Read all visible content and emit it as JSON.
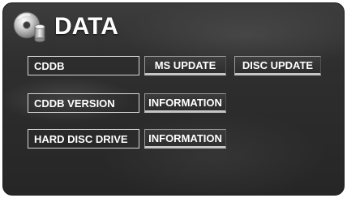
{
  "header": {
    "title": "DATA",
    "icon": "disc-database-icon"
  },
  "rows": [
    {
      "label": "CDDB",
      "buttons": [
        "MS UPDATE",
        "DISC UPDATE"
      ]
    },
    {
      "label": "CDDB VERSION",
      "buttons": [
        "INFORMATION"
      ]
    },
    {
      "label": "HARD DISC DRIVE",
      "buttons": [
        "INFORMATION"
      ]
    }
  ],
  "colors": {
    "background": "#2b2b2b",
    "text": "#ffffff",
    "button_underline": "#c6c6c6"
  }
}
